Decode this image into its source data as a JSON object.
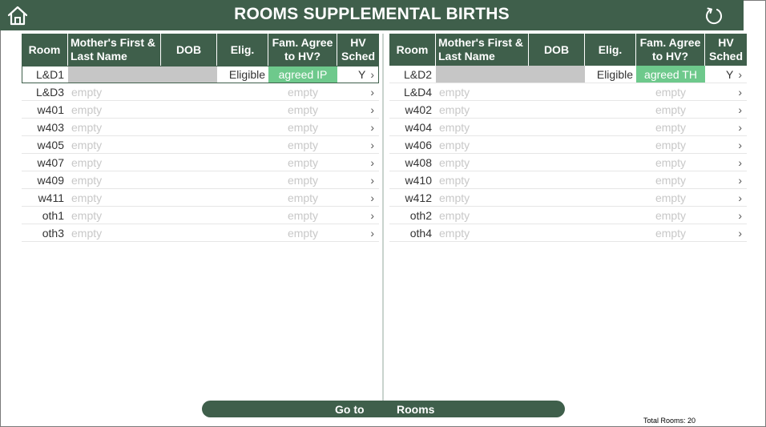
{
  "header": {
    "title": "ROOMS SUPPLEMENTAL BIRTHS",
    "home_icon": "home-icon",
    "refresh_icon": "refresh-icon",
    "bg_color": "#3f5f4b"
  },
  "columns": {
    "room": "Room",
    "name_line1": "Mother's First &",
    "name_line2": "Last Name",
    "dob": "DOB",
    "elig": "Elig.",
    "fam_line1": "Fam. Agree",
    "fam_line2": "to HV?",
    "hv_line1": "HV",
    "hv_line2": "Sched"
  },
  "left_rows": [
    {
      "room": "L&D1",
      "name": "",
      "elig": "Eligible",
      "fam": "agreed  IP",
      "hv": "Y"
    },
    {
      "room": "L&D3",
      "name": "empty",
      "elig": "",
      "fam": "empty",
      "hv": ""
    },
    {
      "room": "w401",
      "name": "empty",
      "elig": "",
      "fam": "empty",
      "hv": ""
    },
    {
      "room": "w403",
      "name": "empty",
      "elig": "",
      "fam": "empty",
      "hv": ""
    },
    {
      "room": "w405",
      "name": "empty",
      "elig": "",
      "fam": "empty",
      "hv": ""
    },
    {
      "room": "w407",
      "name": "empty",
      "elig": "",
      "fam": "empty",
      "hv": ""
    },
    {
      "room": "w409",
      "name": "empty",
      "elig": "",
      "fam": "empty",
      "hv": ""
    },
    {
      "room": "w411",
      "name": "empty",
      "elig": "",
      "fam": "empty",
      "hv": ""
    },
    {
      "room": "oth1",
      "name": "empty",
      "elig": "",
      "fam": "empty",
      "hv": ""
    },
    {
      "room": "oth3",
      "name": "empty",
      "elig": "",
      "fam": "empty",
      "hv": ""
    }
  ],
  "right_rows": [
    {
      "room": "L&D2",
      "name": "",
      "elig": "Eligible",
      "fam": "agreed TH",
      "hv": "Y"
    },
    {
      "room": "L&D4",
      "name": "empty",
      "elig": "",
      "fam": "empty",
      "hv": ""
    },
    {
      "room": "w402",
      "name": "empty",
      "elig": "",
      "fam": "empty",
      "hv": ""
    },
    {
      "room": "w404",
      "name": "empty",
      "elig": "",
      "fam": "empty",
      "hv": ""
    },
    {
      "room": "w406",
      "name": "empty",
      "elig": "",
      "fam": "empty",
      "hv": ""
    },
    {
      "room": "w408",
      "name": "empty",
      "elig": "",
      "fam": "empty",
      "hv": ""
    },
    {
      "room": "w410",
      "name": "empty",
      "elig": "",
      "fam": "empty",
      "hv": ""
    },
    {
      "room": "w412",
      "name": "empty",
      "elig": "",
      "fam": "empty",
      "hv": ""
    },
    {
      "room": "oth2",
      "name": "empty",
      "elig": "",
      "fam": "empty",
      "hv": ""
    },
    {
      "room": "oth4",
      "name": "empty",
      "elig": "",
      "fam": "empty",
      "hv": ""
    }
  ],
  "row_chevron": "›",
  "footer": {
    "goto_left": "Go to",
    "goto_right": "Rooms",
    "total": "Total Rooms: 20"
  },
  "colors": {
    "accent": "#3f5f4b",
    "agreed": "#6ec98c",
    "redacted": "#c6c6c6"
  }
}
